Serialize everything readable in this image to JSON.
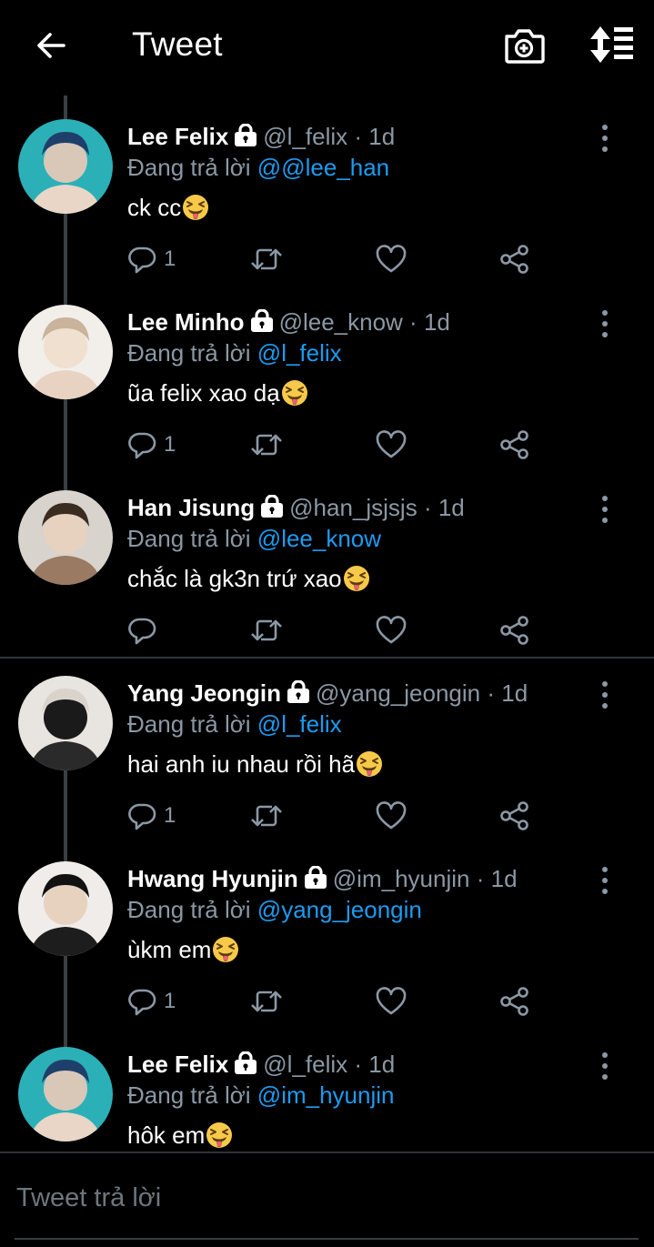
{
  "header": {
    "title": "Tweet",
    "back_icon": "arrow-left-icon",
    "camera_icon": "camera-plus-icon",
    "sort_icon": "sort-icon"
  },
  "colors": {
    "background": "#000000",
    "secondary_text": "#8b98a5",
    "link": "#1d9bf0",
    "divider": "#2f3336"
  },
  "tweets": [
    {
      "name": "Lee Felix",
      "handle": "@l_felix",
      "dot": "·",
      "time": "1d",
      "reply_label": "Đang trả lời",
      "reply_to": "@@lee_han",
      "text": "ck cc",
      "emoji": "😝",
      "reply_count": "1"
    },
    {
      "name": "Lee Minho",
      "handle": "@lee_know",
      "dot": "·",
      "time": "1d",
      "reply_label": "Đang trả lời",
      "reply_to": "@l_felix",
      "text": "ũa felix xao dạ",
      "emoji": "😝",
      "reply_count": "1"
    },
    {
      "name": "Han Jisung",
      "handle": "@han_jsjsjs",
      "dot": "·",
      "time": "1d",
      "reply_label": "Đang trả lời",
      "reply_to": "@lee_know",
      "text": "chắc là gk3n trứ xao",
      "emoji": "😝",
      "reply_count": ""
    },
    {
      "name": "Yang Jeongin",
      "handle": "@yang_jeongin",
      "dot": "·",
      "time": "1d",
      "reply_label": "Đang trả lời",
      "reply_to": "@l_felix",
      "text": "hai anh iu nhau rồi hã",
      "emoji": "😝",
      "reply_count": "1"
    },
    {
      "name": "Hwang Hyunjin",
      "handle": "@im_hyunjin",
      "dot": "·",
      "time": "1d",
      "reply_label": "Đang trả lời",
      "reply_to": "@yang_jeongin",
      "text": "ùkm em",
      "emoji": "😝",
      "reply_count": "1"
    },
    {
      "name": "Lee Felix",
      "handle": "@l_felix",
      "dot": "·",
      "time": "1d",
      "reply_label": "Đang trả lời",
      "reply_to": "@im_hyunjin",
      "text": "hôk em",
      "emoji": "😝",
      "reply_count": ""
    }
  ],
  "composer": {
    "placeholder": "Tweet trả lời"
  }
}
